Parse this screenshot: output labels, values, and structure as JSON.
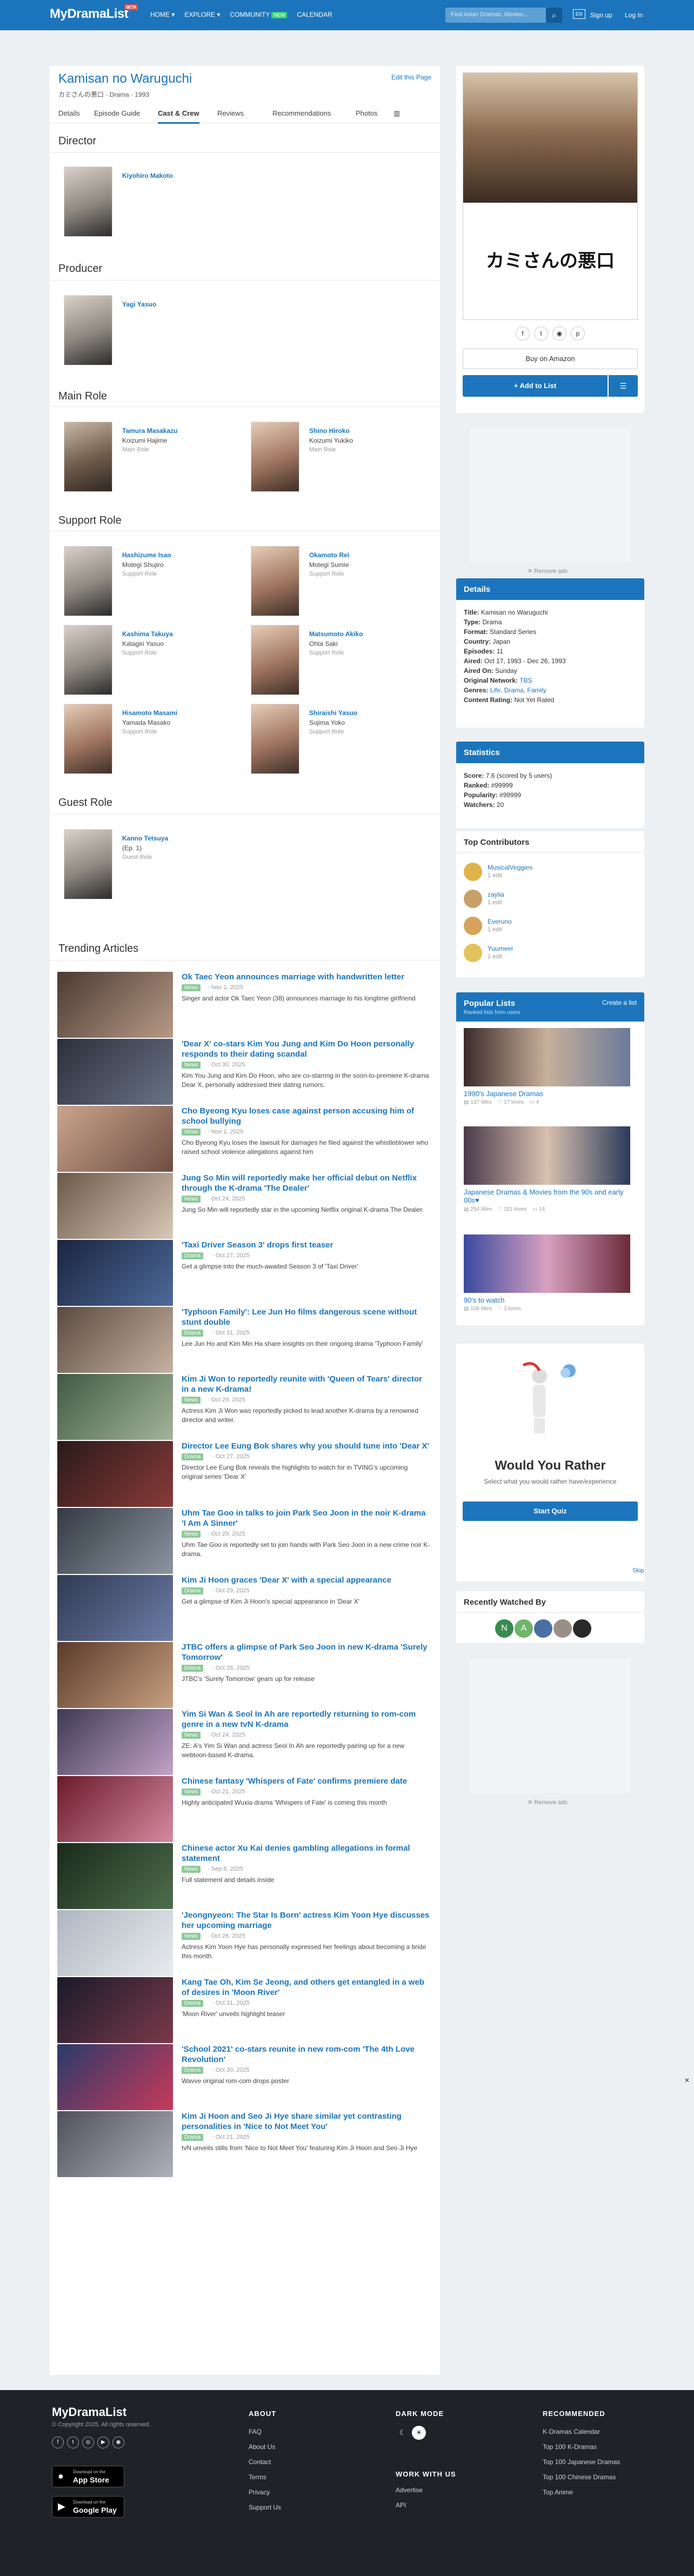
{
  "header": {
    "logo": "MyDramaList",
    "beta": "BETA",
    "nav": [
      "HOME ▾",
      "EXPLORE ▾",
      "COMMUNITY",
      "CALENDAR"
    ],
    "community_badge": "NEW",
    "search_placeholder": "Find Asian Dramas, Movies...",
    "lang": "EN",
    "signup": "Sign up",
    "login": "Log In"
  },
  "drama": {
    "title": "Kamisan no Waruguchi",
    "subtitle": "カミさんの悪口 · Drama · 1993",
    "edit": "Edit this Page",
    "tabs": [
      "Details",
      "Episode Guide",
      "Cast & Crew",
      "Reviews",
      "Recommendations",
      "Photos"
    ],
    "poster_title": "カミさんの悪口"
  },
  "cast": {
    "director_heading": "Director",
    "director": [
      {
        "name": "Kiyohiro Makoto"
      }
    ],
    "producer_heading": "Producer",
    "producer": [
      {
        "name": "Yagi Yasuo"
      }
    ],
    "main_heading": "Main Role",
    "main": [
      {
        "name": "Tamura Masakazu",
        "character": "Koizumi Hajime",
        "role": "Main Role"
      },
      {
        "name": "Shino Hiroko",
        "character": "Koizumi Yukiko",
        "role": "Main Role"
      }
    ],
    "support_heading": "Support Role",
    "support": [
      {
        "name": "Hashizume Isao",
        "character": "Motegi Shujiro",
        "role": "Support Role"
      },
      {
        "name": "Okamoto Rei",
        "character": "Motegi Sumie",
        "role": "Support Role"
      },
      {
        "name": "Kashima Takuya",
        "character": "Katagiri Yasuo",
        "role": "Support Role"
      },
      {
        "name": "Matsumoto Akiko",
        "character": "Ohta Saki",
        "role": "Support Role"
      },
      {
        "name": "Hisamoto Masami",
        "character": "Yamada Masako",
        "role": "Support Role"
      },
      {
        "name": "Shiraishi Yasuo",
        "character": "Sojima Yoko",
        "role": "Support Role"
      }
    ],
    "guest_heading": "Guest Role",
    "guest": [
      {
        "name": "Kanno Tetsuya",
        "character": "(Ep. 1)",
        "role": "Guest Role"
      }
    ]
  },
  "articles": {
    "heading": "Trending Articles",
    "items": [
      {
        "title": "Ok Taec Yeon announces marriage with handwritten letter",
        "tag": "News",
        "date": "· Nov 1, 2025",
        "desc": "Singer and actor Ok Taec Yeon (38) announces marriage to his longtime girlfriend"
      },
      {
        "title": "'Dear X' co-stars Kim You Jung and Kim Do Hoon personally responds to their dating scandal",
        "tag": "News",
        "date": "· Oct 30, 2025",
        "desc": "Kim You Jung and Kim Do Hoon, who are co-starring in the soon-to-premiere K-drama Dear X, personally addressed their dating rumors."
      },
      {
        "title": "Cho Byeong Kyu loses case against person accusing him of school bullying",
        "tag": "News",
        "date": "· Nov 1, 2025",
        "desc": "Cho Byeong Kyu loses the lawsuit for damages he filed against the whistleblower who raised school violence allegations against him"
      },
      {
        "title": "Jung So Min will reportedly make her official debut on Netflix through the K-drama 'The Dealer'",
        "tag": "News",
        "date": "· Oct 24, 2025",
        "desc": "Jung So Min will reportedly star in the upcoming Netflix original K-drama The Dealer."
      },
      {
        "title": "'Taxi Driver Season 3' drops first teaser",
        "tag": "Drama",
        "date": "· Oct 27, 2025",
        "desc": "Get a glimpse into the much-awaited Season 3 of 'Taxi Driver'"
      },
      {
        "title": "'Typhoon Family': Lee Jun Ho films dangerous scene without stunt double",
        "tag": "Drama",
        "date": "· Oct 31, 2025",
        "desc": "Lee Jun Ho and Kim Min Ha share insights on their ongoing drama 'Typhoon Family'"
      },
      {
        "title": "Kim Ji Won to reportedly reunite with 'Queen of Tears' director in a new K-drama!",
        "tag": "News",
        "date": "· Oct 29, 2025",
        "desc": "Actress Kim Ji Won was reportedly picked to lead another K-drama by a renowned director and writer."
      },
      {
        "title": "Director Lee Eung Bok shares why you should tune into 'Dear X'",
        "tag": "Drama",
        "date": "· Oct 27, 2025",
        "desc": "Director Lee Eung Bok reveals the highlights to watch for in TVING's upcoming original series 'Dear X'"
      },
      {
        "title": "Uhm Tae Goo in talks to join Park Seo Joon in the noir K-drama 'I Am A Sinner'",
        "tag": "News",
        "date": "· Oct 29, 2025",
        "desc": "Uhm Tae Goo is reportedly set to join hands with Park Seo Joon in a new crime noir K-drama."
      },
      {
        "title": "Kim Ji Hoon graces 'Dear X' with a special appearance",
        "tag": "Drama",
        "date": "· Oct 29, 2025",
        "desc": "Get a glimpse of Kim Ji Hoon's special appearance in 'Dear X'"
      },
      {
        "title": "JTBC offers a glimpse of Park Seo Joon in new K-drama 'Surely Tomorrow'",
        "tag": "Drama",
        "date": "· Oct 28, 2025",
        "desc": "JTBC's 'Surely Tomorrow' gears up for release"
      },
      {
        "title": "Yim Si Wan & Seol In Ah are reportedly returning to rom-com genre in a new tvN K-drama",
        "tag": "News",
        "date": "· Oct 24, 2025",
        "desc": "ZE: A's Yim Si Wan and actress Seol In Ah are reportedly pairing up for a new webtoon-based K-drama."
      },
      {
        "title": "Chinese fantasy 'Whispers of Fate' confirms premiere date",
        "tag": "News",
        "date": "· Oct 21, 2025",
        "desc": "Highly anticipated Wuxia drama 'Whispers of Fate' is coming this month"
      },
      {
        "title": "Chinese actor Xu Kai denies gambling allegations in formal statement",
        "tag": "News",
        "date": "· Sep 8, 2025",
        "desc": "Full statement and details inside"
      },
      {
        "title": "'Jeongnyeon: The Star Is Born' actress Kim Yoon Hye discusses her upcoming marriage",
        "tag": "News",
        "date": "· Oct 28, 2025",
        "desc": "Actress Kim Yoon Hye has personally expressed her feelings about becoming a bride this month."
      },
      {
        "title": "Kang Tae Oh, Kim Se Jeong, and others get entangled in a web of desires in 'Moon River'",
        "tag": "Drama",
        "date": "· Oct 31, 2025",
        "desc": "'Moon River' unveils highlight teaser"
      },
      {
        "title": "'School 2021' co-stars reunite in new rom-com 'The 4th Love Revolution'",
        "tag": "Drama",
        "date": "· Oct 30, 2025",
        "desc": "Wavve original rom-com drops poster"
      },
      {
        "title": "Kim Ji Hoon and Seo Ji Hye share similar yet contrasting personalities in 'Nice to Not Meet You'",
        "tag": "Drama",
        "date": "· Oct 21, 2025",
        "desc": "tvN unveils stills from 'Nice to Not Meet You' featuring Kim Ji Hoon and Seo Ji Hye"
      }
    ]
  },
  "sidebar": {
    "buy_amazon": "Buy on Amazon",
    "add_to_list": "+ Add to List",
    "remove_ads": "✕ Remove ads",
    "details": {
      "heading": "Details",
      "rows": [
        {
          "label": "Title:",
          "value": "Kamisan no Waruguchi"
        },
        {
          "label": "Type:",
          "value": "Drama"
        },
        {
          "label": "Format:",
          "value": "Standard Series"
        },
        {
          "label": "Country:",
          "value": "Japan"
        },
        {
          "label": "Episodes:",
          "value": "11"
        },
        {
          "label": "Aired:",
          "value": "Oct 17, 1993 - Dec 26, 1993"
        },
        {
          "label": "Aired On:",
          "value": "Sunday"
        },
        {
          "label": "Original Network:",
          "value": "TBS"
        },
        {
          "label": "Genres:",
          "value": "Life, Drama, Family"
        },
        {
          "label": "Content Rating:",
          "value": "Not Yet Rated"
        }
      ]
    },
    "statistics": {
      "heading": "Statistics",
      "rows": [
        {
          "label": "Score:",
          "value": "7.6 (scored by 5 users)"
        },
        {
          "label": "Ranked:",
          "value": "#99999"
        },
        {
          "label": "Popularity:",
          "value": "#99999"
        },
        {
          "label": "Watchers:",
          "value": "20"
        }
      ]
    },
    "contributors": {
      "heading": "Top Contributors",
      "items": [
        {
          "name": "MusicalVeggies",
          "edits": "1 edit"
        },
        {
          "name": "zaylia",
          "edits": "1 edit"
        },
        {
          "name": "Everuno",
          "edits": "1 edit"
        },
        {
          "name": "Yuumeei",
          "edits": "1 edit"
        }
      ]
    },
    "popular_lists": {
      "heading": "Popular Lists",
      "subheading": "Ranked lists from users",
      "create": "Create a list",
      "items": [
        {
          "title": "1990's Japanese Dramas",
          "titles": "137 titles",
          "loves": "17 loves",
          "comments": "4"
        },
        {
          "title": "Japanese Dramas & Movies from the 90s and early 00s♥",
          "titles": "294 titles",
          "loves": "161 loves",
          "comments": "14"
        },
        {
          "title": "90's to watch",
          "titles": "108 titles",
          "loves": "3 loves",
          "comments": ""
        }
      ]
    },
    "quiz": {
      "title": "Would You Rather",
      "desc": "Select what you would rather have/experience",
      "button": "Start Quiz",
      "skip": "Skip"
    },
    "recently_watched": {
      "heading": "Recently Watched By",
      "avatars": [
        "N",
        "A",
        "",
        "",
        ""
      ]
    }
  },
  "footer": {
    "logo": "MyDramaList",
    "copyright": "© Copyright 2025. All rights reserved.",
    "app_store_small": "Download on the",
    "app_store": "App Store",
    "google_small": "Download on the",
    "google": "Google Play",
    "about_heading": "ABOUT",
    "about_links": [
      "FAQ",
      "About Us",
      "Contact",
      "Terms",
      "Privacy",
      "Support Us"
    ],
    "dark_heading": "DARK MODE",
    "work_heading": "WORK WITH US",
    "work_links": [
      "Advertise",
      "API"
    ],
    "rec_heading": "RECOMMENDED",
    "rec_links": [
      "K-Dramas Calendar",
      "Top 100 K-Dramas",
      "Top 100 Japanese Dramas",
      "Top 100 Chinese Dramas",
      "Top Anime"
    ]
  },
  "colors": {
    "brand": "#1c75bc",
    "footer_bg": "#1f2328",
    "tag": "#8ec99a"
  }
}
